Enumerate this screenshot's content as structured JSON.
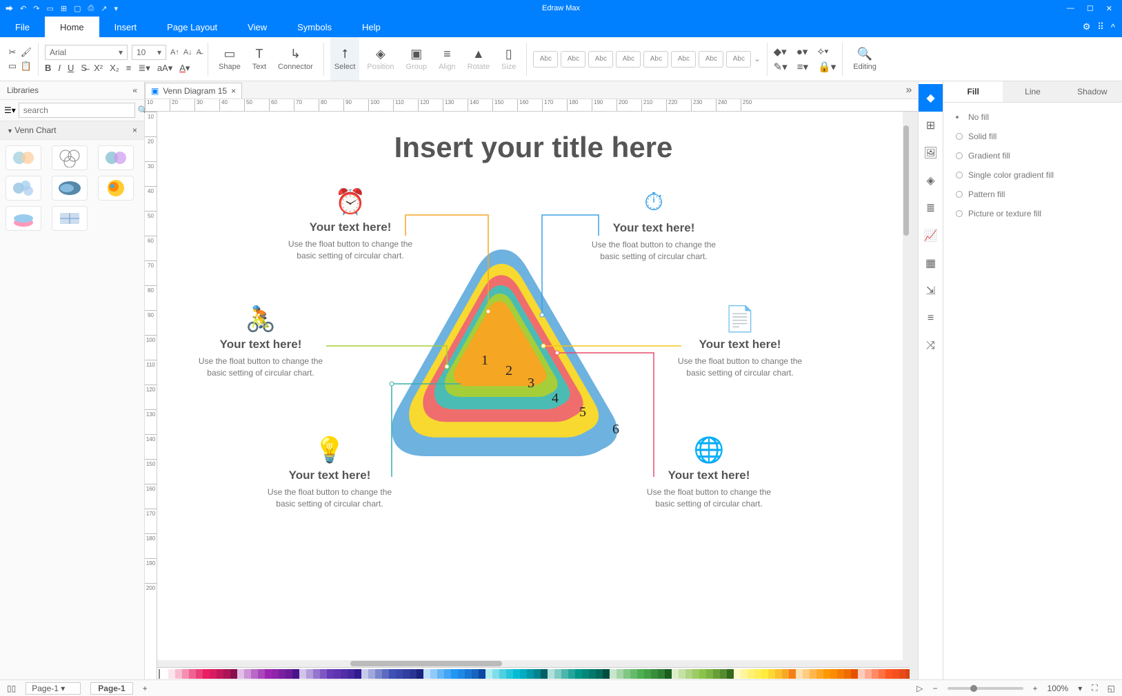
{
  "app": {
    "title": "Edraw Max"
  },
  "menus": [
    "File",
    "Home",
    "Insert",
    "Page Layout",
    "View",
    "Symbols",
    "Help"
  ],
  "active_menu": "Home",
  "font": {
    "family": "Arial",
    "size": "10"
  },
  "ribbon_groups": [
    "Shape",
    "Text",
    "Connector",
    "Select",
    "Position",
    "Group",
    "Align",
    "Rotate",
    "Size",
    "Editing"
  ],
  "ribbon_theme_label": "Abc",
  "sidebar": {
    "title": "Libraries",
    "search_placeholder": "search",
    "category": "Venn Chart"
  },
  "tab": {
    "name": "Venn Diagram 15"
  },
  "ruler_h": [
    "10",
    "20",
    "30",
    "40",
    "50",
    "60",
    "70",
    "80",
    "90",
    "100",
    "110",
    "120",
    "130",
    "140",
    "150",
    "160",
    "170",
    "180",
    "190",
    "200",
    "210",
    "220",
    "230",
    "240",
    "250"
  ],
  "ruler_v": [
    "10",
    "20",
    "30",
    "40",
    "50",
    "60",
    "70",
    "80",
    "90",
    "100",
    "110",
    "120",
    "130",
    "140",
    "150",
    "160",
    "170",
    "180",
    "190",
    "200"
  ],
  "canvas": {
    "title": "Insert your title here",
    "callouts": [
      {
        "heading": "Your text here!",
        "body": "Use the float button to change the basic setting of circular chart.",
        "color": "#f5a623"
      },
      {
        "heading": "Your text here!",
        "body": "Use the float button to change the basic setting of circular chart.",
        "color": "#3aa0e8"
      },
      {
        "heading": "Your text here!",
        "body": "Use the float button to change the basic setting of circular chart.",
        "color": "#a6ce39"
      },
      {
        "heading": "Your text here!",
        "body": "Use the float button to change the basic setting of circular chart.",
        "color": "#f5c518"
      },
      {
        "heading": "Your text here!",
        "body": "Use the float button to change the basic setting of circular chart.",
        "color": "#37b2a8"
      },
      {
        "heading": "Your text here!",
        "body": "Use the float button to change the basic setting of circular chart.",
        "color": "#e94b6e"
      }
    ],
    "layers": [
      {
        "n": "6",
        "color": "#6eb2df"
      },
      {
        "n": "5",
        "color": "#f7d930"
      },
      {
        "n": "4",
        "color": "#ef6d6d"
      },
      {
        "n": "3",
        "color": "#4bbcb4"
      },
      {
        "n": "2",
        "color": "#a6ce39"
      },
      {
        "n": "1",
        "color": "#f5a623"
      }
    ]
  },
  "rightpanel": {
    "tabs": [
      "Fill",
      "Line",
      "Shadow"
    ],
    "active": "Fill",
    "options": [
      "No fill",
      "Solid fill",
      "Gradient fill",
      "Single color gradient fill",
      "Pattern fill",
      "Picture or texture fill"
    ]
  },
  "status": {
    "page_selector": "Page-1",
    "page_tab": "Page-1",
    "zoom": "100%"
  },
  "color_swatches": [
    "#ffffff",
    "#fce4ec",
    "#f8bbd0",
    "#f48fb1",
    "#f06292",
    "#ec407a",
    "#e91e63",
    "#d81b60",
    "#c2185b",
    "#ad1457",
    "#880e4f",
    "#e1bee7",
    "#ce93d8",
    "#ba68c8",
    "#ab47bc",
    "#9c27b0",
    "#8e24aa",
    "#7b1fa2",
    "#6a1b9a",
    "#4a148c",
    "#d1c4e9",
    "#b39ddb",
    "#9575cd",
    "#7e57c2",
    "#673ab7",
    "#5e35b1",
    "#512da8",
    "#4527a0",
    "#311b92",
    "#c5cae9",
    "#9fa8da",
    "#7986cb",
    "#5c6bc0",
    "#3f51b5",
    "#3949ab",
    "#303f9f",
    "#283593",
    "#1a237e",
    "#bbdefb",
    "#90caf9",
    "#64b5f6",
    "#42a5f5",
    "#2196f3",
    "#1e88e5",
    "#1976d2",
    "#1565c0",
    "#0d47a1",
    "#b2ebf2",
    "#80deea",
    "#4dd0e1",
    "#26c6da",
    "#00bcd4",
    "#00acc1",
    "#0097a7",
    "#00838f",
    "#006064",
    "#b2dfdb",
    "#80cbc4",
    "#4db6ac",
    "#26a69a",
    "#009688",
    "#00897b",
    "#00796b",
    "#00695c",
    "#004d40",
    "#c8e6c9",
    "#a5d6a7",
    "#81c784",
    "#66bb6a",
    "#4caf50",
    "#43a047",
    "#388e3c",
    "#2e7d32",
    "#1b5e20",
    "#dcedc8",
    "#c5e1a5",
    "#aed581",
    "#9ccc65",
    "#8bc34a",
    "#7cb342",
    "#689f38",
    "#558b2f",
    "#33691e",
    "#fff9c4",
    "#fff59d",
    "#fff176",
    "#ffee58",
    "#ffeb3b",
    "#fdd835",
    "#fbc02d",
    "#f9a825",
    "#f57f17",
    "#ffe0b2",
    "#ffcc80",
    "#ffb74d",
    "#ffa726",
    "#ff9800",
    "#fb8c00",
    "#f57c00",
    "#ef6c00",
    "#e65100",
    "#ffccbc",
    "#ffab91",
    "#ff8a65",
    "#ff7043",
    "#ff5722",
    "#f4511e",
    "#e64a19",
    "#d84315",
    "#bf360c",
    "#d7ccc8",
    "#bcaaa4",
    "#a1887f",
    "#8d6e63",
    "#795548",
    "#6d4c41",
    "#5d4037",
    "#4e342e",
    "#3e2723",
    "#cfd8dc",
    "#b0bec5",
    "#90a4ae",
    "#78909c",
    "#607d8b",
    "#546e7a",
    "#455a64",
    "#37474f",
    "#263238",
    "#f5f5f5",
    "#e0e0e0",
    "#bdbdbd",
    "#9e9e9e",
    "#757575",
    "#616161",
    "#424242",
    "#212121",
    "#000000"
  ]
}
